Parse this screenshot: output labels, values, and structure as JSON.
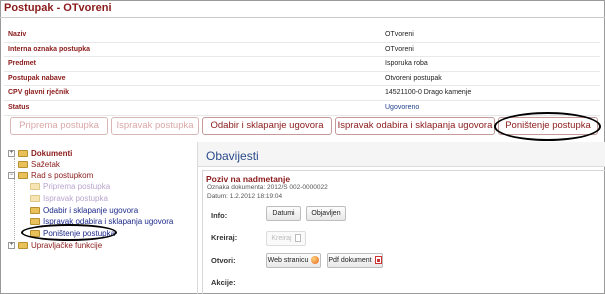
{
  "header": {
    "title": "Postupak - OTvoreni"
  },
  "details": [
    {
      "label": "Naziv",
      "value": "OTvoreni"
    },
    {
      "label": "Interna oznaka postupka",
      "value": "OTvoreni"
    },
    {
      "label": "Predmet",
      "value": "Isporuka roba"
    },
    {
      "label": "Postupak nabave",
      "value": "Otvoreni postupak"
    },
    {
      "label": "CPV glavni rječnik",
      "value": "14521100-0 Drago kamenje"
    },
    {
      "label": "Status",
      "value": "Ugovoreno"
    }
  ],
  "tabs": [
    {
      "label": "Priprema postupka",
      "state": "disabled"
    },
    {
      "label": "Ispravak postupka",
      "state": "disabled"
    },
    {
      "label": "Odabir i sklapanje ugovora",
      "state": "enabled"
    },
    {
      "label": "Ispravak odabira i sklapanja ugovora",
      "state": "enabled"
    },
    {
      "label": "Poništenje postupka",
      "state": "enabled",
      "highlighted": true
    }
  ],
  "tree": {
    "dokumenti": "Dokumenti",
    "sazetak": "Sažetak",
    "rad": "Rad s postupkom",
    "priprema": "Priprema postupka",
    "ispravak": "Ispravak postupka",
    "odabir": "Odabir i sklapanje ugovora",
    "ispravak_odabira": "Ispravak odabira i sklapanja ugovora",
    "ponistenje": "Poništenje postupka",
    "upravljacke": "Upravljačke funkcije"
  },
  "panel": {
    "title": "Obavijesti",
    "notice_title": "Poziv na nadmetanje",
    "notice_ref": "Oznaka dokumenta: 2012/S 002-0000022",
    "notice_date": "Datum: 1.2.2012 18:19:04",
    "labels": {
      "info": "Info:",
      "kreiraj": "Kreiraj:",
      "otvori": "Otvori:",
      "akcije": "Akcije:"
    },
    "buttons": {
      "datumi": "Datumi",
      "objavljen": "Objavljen",
      "kreiraj": "Kreiraj",
      "web": "Web stranicu",
      "pdf": "Pdf dokument"
    }
  },
  "colors": {
    "accent": "#8b1a1a",
    "link": "#1f3f8f",
    "annotation": "#000000"
  }
}
